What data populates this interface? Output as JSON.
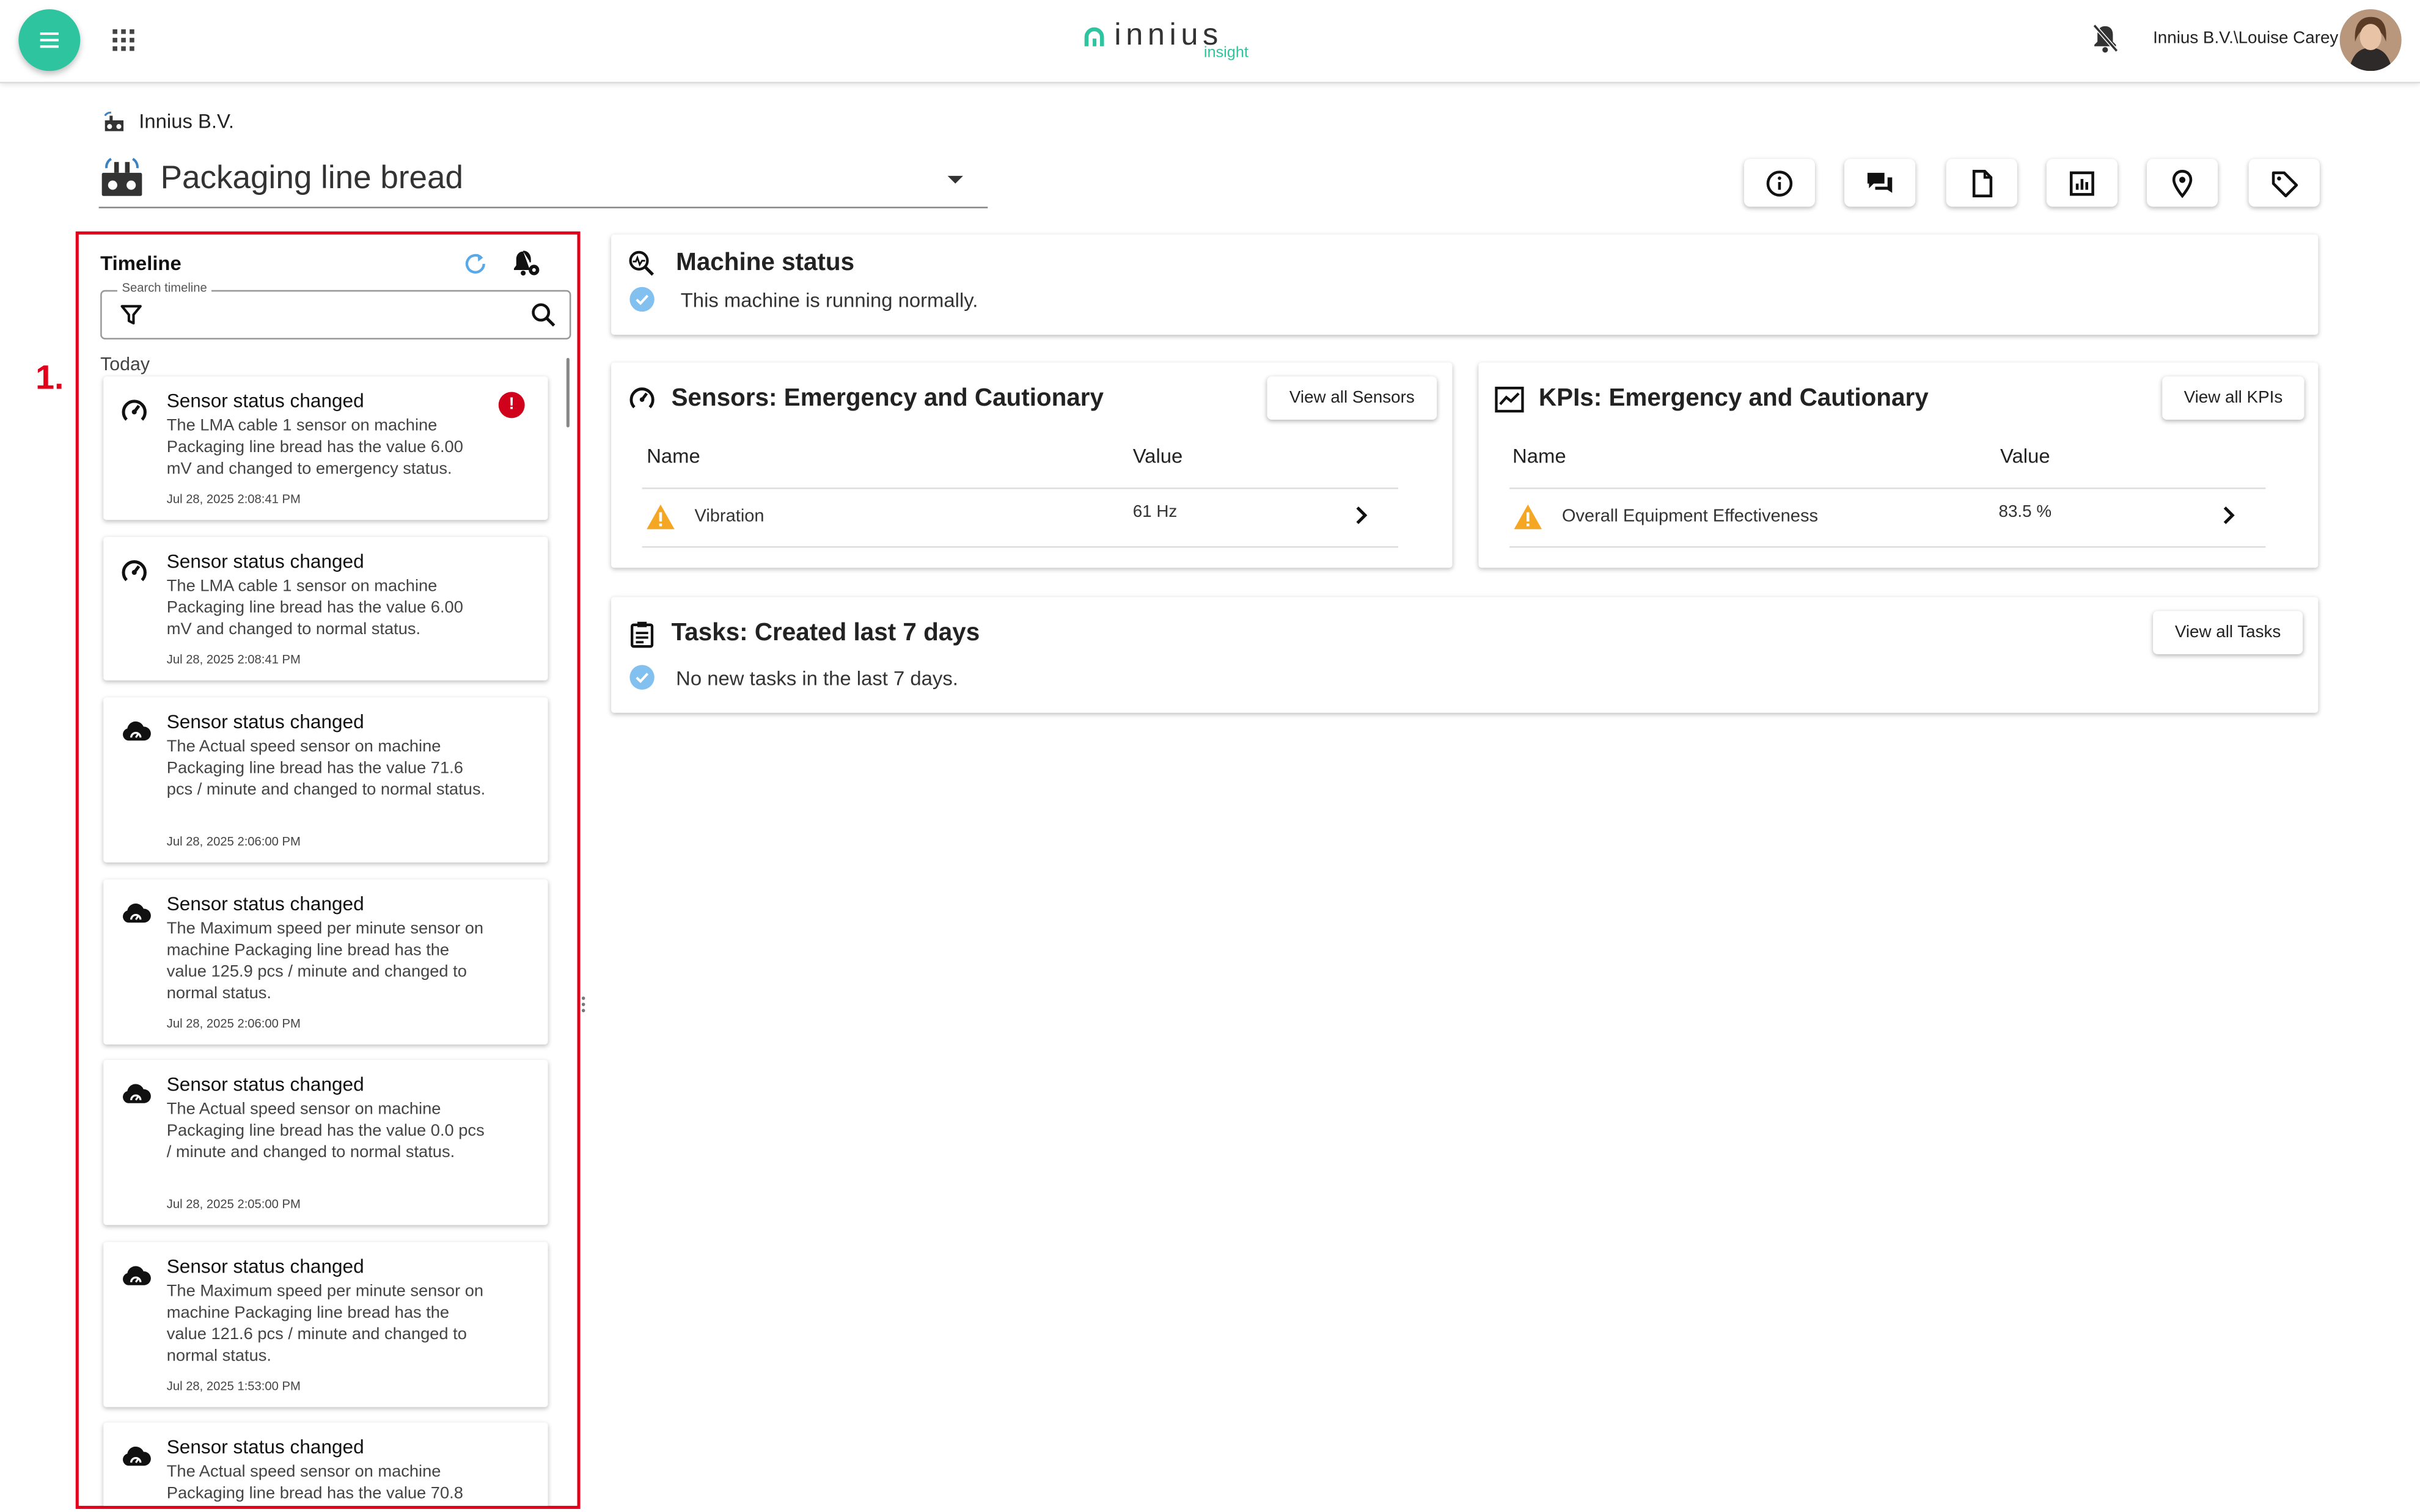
{
  "app": {
    "logo_text": "innius",
    "logo_sub": "insight",
    "user_path": "Innius B.V.\\Louise Carey"
  },
  "header": {
    "company": "Innius B.V.",
    "machine_name": "Packaging line bread",
    "toolbar_icons": [
      "info-icon",
      "chat-icon",
      "document-icon",
      "report-icon",
      "location-icon",
      "tag-icon"
    ]
  },
  "annotation": {
    "marker": "1."
  },
  "timeline": {
    "title": "Timeline",
    "search_legend": "Search timeline",
    "group_label": "Today",
    "items": [
      {
        "title": "Sensor status changed",
        "text": "The LMA cable 1 sensor on machine Packaging line bread has the value 6.00 mV and changed to emergency status.",
        "time": "Jul 28, 2025 2:08:41 PM",
        "icon": "gauge-icon",
        "badge": "!"
      },
      {
        "title": "Sensor status changed",
        "text": "The LMA cable 1 sensor on machine Packaging line bread has the value 6.00 mV and changed to normal status.",
        "time": "Jul 28, 2025 2:08:41 PM",
        "icon": "gauge-icon"
      },
      {
        "title": "Sensor status changed",
        "text": "The Actual speed sensor on machine Packaging line bread has the value 71.6 pcs / minute and changed to normal status.",
        "time": "Jul 28, 2025 2:06:00 PM",
        "icon": "cloud-gauge-icon"
      },
      {
        "title": "Sensor status changed",
        "text": "The Maximum speed per minute sensor on machine Packaging line bread has the value 125.9 pcs / minute and changed to normal status.",
        "time": "Jul 28, 2025 2:06:00 PM",
        "icon": "cloud-gauge-icon"
      },
      {
        "title": "Sensor status changed",
        "text": "The Actual speed sensor on machine Packaging line bread has the value 0.0 pcs / minute and changed to normal status.",
        "time": "Jul 28, 2025 2:05:00 PM",
        "icon": "cloud-gauge-icon"
      },
      {
        "title": "Sensor status changed",
        "text": "The Maximum speed per minute sensor on machine Packaging line bread has the value 121.6 pcs / minute and changed to normal status.",
        "time": "Jul 28, 2025 1:53:00 PM",
        "icon": "cloud-gauge-icon"
      },
      {
        "title": "Sensor status changed",
        "text": "The Actual speed sensor on machine Packaging line bread has the value 70.8",
        "time": "",
        "icon": "cloud-gauge-icon"
      }
    ]
  },
  "machine_status": {
    "title": "Machine status",
    "message": "This machine is running normally."
  },
  "sensors": {
    "title": "Sensors: Emergency and Cautionary",
    "button": "View all Sensors",
    "col_name": "Name",
    "col_value": "Value",
    "rows": [
      {
        "name": "Vibration",
        "value": "61 Hz",
        "status": "warning"
      }
    ]
  },
  "kpis": {
    "title": "KPIs: Emergency and Cautionary",
    "button": "View all KPIs",
    "col_name": "Name",
    "col_value": "Value",
    "rows": [
      {
        "name": "Overall Equipment Effectiveness",
        "value": "83.5 %",
        "status": "warning"
      }
    ]
  },
  "tasks": {
    "title": "Tasks: Created last 7 days",
    "button": "View all Tasks",
    "message": "No new tasks in the last 7 days."
  },
  "colors": {
    "accent": "#2ec4a0",
    "highlight": "#e2001a",
    "error": "#d0021b",
    "warning": "#f5a623",
    "ok": "#82c0f0"
  }
}
